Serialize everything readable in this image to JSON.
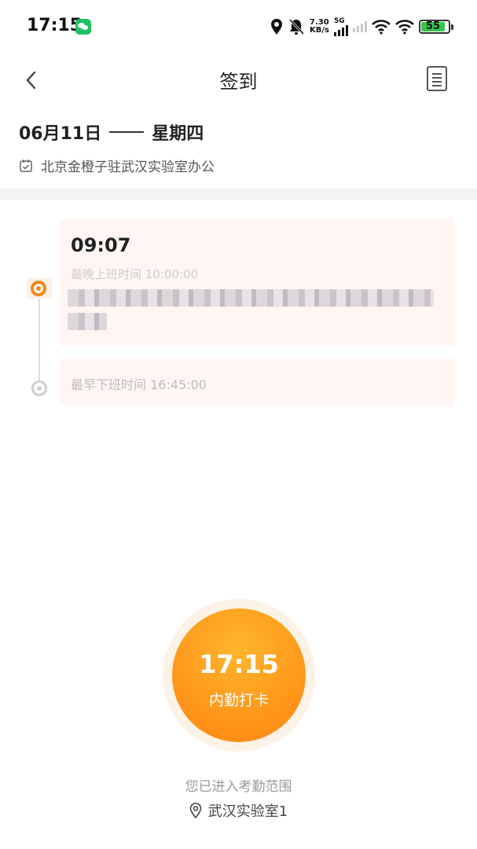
{
  "status_bar": {
    "time": "17:15",
    "speed_value": "7.30",
    "speed_unit": "KB/s",
    "network": "5G",
    "battery": "55",
    "icons": [
      "wechat-icon",
      "location-icon",
      "bell-mute-icon",
      "signal-icon",
      "wifi-icon",
      "battery-icon"
    ]
  },
  "nav": {
    "title": "签到",
    "back_icon": "chevron-left-icon",
    "record_icon": "list-document-icon"
  },
  "header": {
    "date": "06月11日",
    "weekday": "星期四",
    "group": "北京金橙子驻武汉实验室办公"
  },
  "timeline": {
    "check_in": {
      "time": "09:07",
      "limit_label": "最晚上班时间 10:00:00"
    },
    "check_out": {
      "limit_label": "最早下班时间 16:45:00"
    }
  },
  "punch": {
    "time": "17:15",
    "label": "内勤打卡"
  },
  "footer": {
    "range_text": "您已进入考勤范围",
    "location": "武汉实验室1"
  },
  "colors": {
    "accent": "#ff9a1c",
    "card_bg": "#fff6f4",
    "battery_fill": "#35c54c"
  }
}
